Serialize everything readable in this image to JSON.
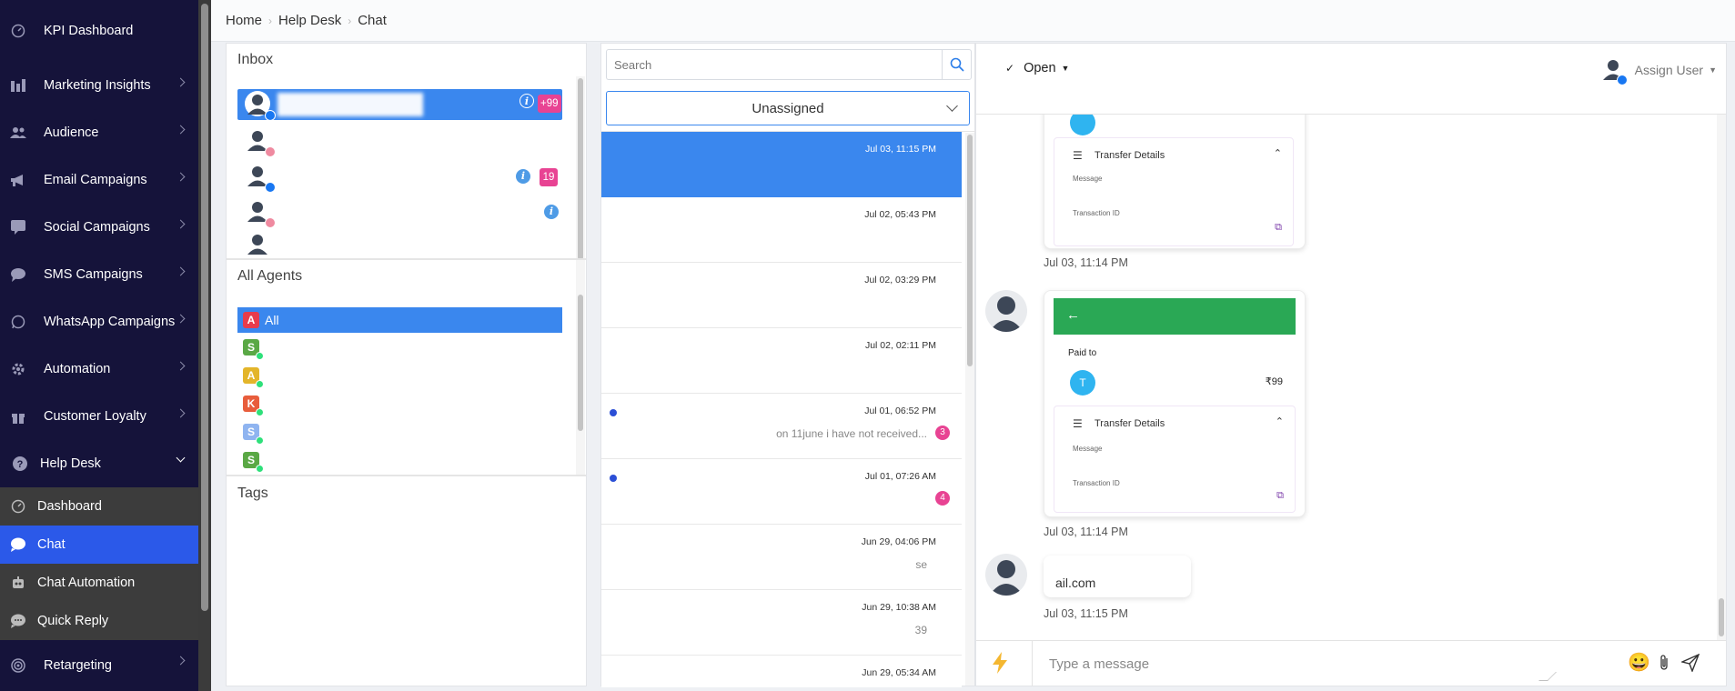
{
  "sidebar": {
    "items": [
      {
        "label": "KPI Dashboard",
        "icon": "gauge-icon",
        "chevron": false
      },
      {
        "label": "Marketing Insights",
        "icon": "chart-bars-icon",
        "chevron": true
      },
      {
        "label": "Audience",
        "icon": "users-icon",
        "chevron": true
      },
      {
        "label": "Email Campaigns",
        "icon": "megaphone-icon",
        "chevron": true
      },
      {
        "label": "Social Campaigns",
        "icon": "social-icon",
        "chevron": true
      },
      {
        "label": "SMS Campaigns",
        "icon": "sms-icon",
        "chevron": true
      },
      {
        "label": "WhatsApp Campaigns",
        "icon": "whatsapp-icon",
        "chevron": true
      },
      {
        "label": "Automation",
        "icon": "gear-icon",
        "chevron": true
      },
      {
        "label": "Customer Loyalty",
        "icon": "gift-icon",
        "chevron": true
      },
      {
        "label": "Help Desk",
        "icon": "help-icon",
        "chevron": "down"
      }
    ],
    "subitems": [
      {
        "label": "Dashboard",
        "icon": "gauge-icon",
        "active": false
      },
      {
        "label": "Chat",
        "icon": "chat-bubble-icon",
        "active": true
      },
      {
        "label": "Chat Automation",
        "icon": "robot-icon",
        "active": false
      },
      {
        "label": "Quick Reply",
        "icon": "quick-reply-icon",
        "active": false
      }
    ],
    "bottom_item": {
      "label": "Retargeting",
      "icon": "target-icon"
    }
  },
  "breadcrumb": [
    "Home",
    "Help Desk",
    "Chat"
  ],
  "inbox": {
    "title": "Inbox",
    "badges": {
      "first_count": "+99",
      "third_count": "19"
    }
  },
  "agents": {
    "title": "All Agents",
    "list": [
      {
        "initial": "A",
        "name": "All",
        "color": "#e83c4c",
        "online": false
      },
      {
        "initial": "S",
        "name": "",
        "color": "#5aa845",
        "online": true
      },
      {
        "initial": "A",
        "name": "",
        "color": "#e3b52a",
        "online": true
      },
      {
        "initial": "K",
        "name": "",
        "color": "#e85d3c",
        "online": true
      },
      {
        "initial": "S",
        "name": "",
        "color": "#8fb4f0",
        "online": true
      },
      {
        "initial": "S",
        "name": "",
        "color": "#5aa845",
        "online": true
      }
    ]
  },
  "tags": {
    "title": "Tags"
  },
  "search": {
    "placeholder": "Search"
  },
  "filter": {
    "selected": "Unassigned"
  },
  "conversations": [
    {
      "time": "Jul 03, 11:15 PM",
      "preview": "",
      "unread": "",
      "dot": false,
      "selected": true
    },
    {
      "time": "Jul 02, 05:43 PM",
      "preview": "",
      "unread": "",
      "dot": false,
      "selected": false
    },
    {
      "time": "Jul 02, 03:29 PM",
      "preview": "",
      "unread": "",
      "dot": false,
      "selected": false
    },
    {
      "time": "Jul 02, 02:11 PM",
      "preview": "",
      "unread": "",
      "dot": false,
      "selected": false
    },
    {
      "time": "Jul 01, 06:52 PM",
      "preview": "on 11june i have not received...",
      "unread": "3",
      "dot": true,
      "selected": false
    },
    {
      "time": "Jul 01, 07:26 AM",
      "preview": "",
      "unread": "4",
      "dot": true,
      "selected": false
    },
    {
      "time": "Jun 29, 04:06 PM",
      "preview": "se",
      "unread": "",
      "dot": false,
      "selected": false
    },
    {
      "time": "Jun 29, 10:38 AM",
      "preview": "39",
      "unread": "",
      "dot": false,
      "selected": false
    },
    {
      "time": "Jun 29, 05:34 AM",
      "preview": "",
      "unread": "",
      "dot": false,
      "selected": false
    }
  ],
  "chat": {
    "status": "Open",
    "assign_label": "Assign User",
    "messages": [
      {
        "card_title": "Transfer Details",
        "message_label": "Message",
        "transaction_label": "Transaction ID",
        "time": "Jul 03, 11:14 PM"
      },
      {
        "paid_to_label": "Paid to",
        "payee_initial": "T",
        "amount": "₹99",
        "card_title": "Transfer Details",
        "message_label": "Message",
        "transaction_label": "Transaction ID",
        "time": "Jul 03, 11:14 PM"
      },
      {
        "text": "ail.com",
        "time": "Jul 03, 11:15 PM"
      }
    ],
    "composer_placeholder": "Type a message"
  },
  "colors": {
    "sidebar_bg": "#15133a",
    "accent": "#3a87ee",
    "active_nav": "#2b59e9",
    "pink": "#e84393",
    "payment_green": "#2aa855"
  }
}
